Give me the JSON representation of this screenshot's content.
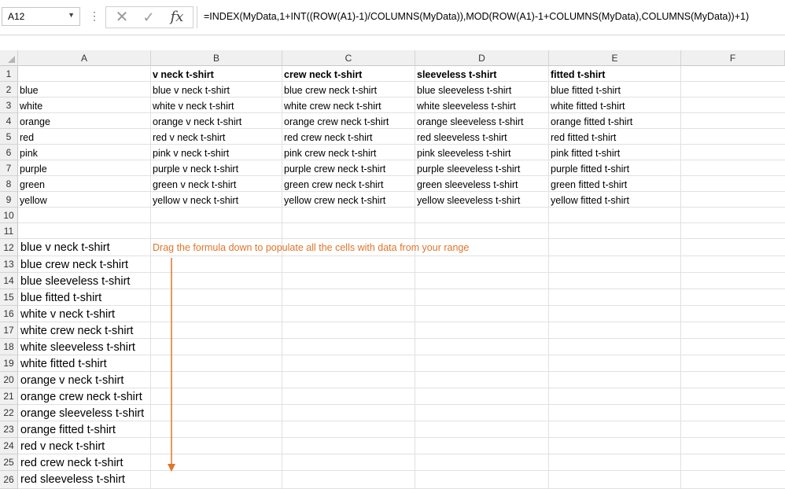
{
  "namebox": {
    "cell": "A12",
    "dropdown_icon": "chevron-down-icon"
  },
  "formula_bar": {
    "cancel_icon": "cancel-x-icon",
    "enter_icon": "check-icon",
    "fx_label": "fx",
    "formula": "=INDEX(MyData,1+INT((ROW(A1)-1)/COLUMNS(MyData)),MOD(ROW(A1)-1+COLUMNS(MyData),COLUMNS(MyData))+1)"
  },
  "columns": [
    "A",
    "B",
    "C",
    "D",
    "E",
    "F"
  ],
  "rows": [
    "1",
    "2",
    "3",
    "4",
    "5",
    "6",
    "7",
    "8",
    "9",
    "10",
    "11",
    "12",
    "13",
    "14",
    "15",
    "16",
    "17",
    "18",
    "19",
    "20",
    "21",
    "22",
    "23",
    "24",
    "25",
    "26"
  ],
  "header_row": [
    "v neck t-shirt",
    "crew neck t-shirt",
    "sleeveless t-shirt",
    "fitted t-shirt"
  ],
  "colors": [
    "blue",
    "white",
    "orange",
    "red",
    "pink",
    "purple",
    "green",
    "yellow"
  ],
  "table": [
    [
      "blue v neck t-shirt",
      "blue crew neck t-shirt",
      "blue sleeveless t-shirt",
      "blue fitted t-shirt"
    ],
    [
      "white v neck t-shirt",
      "white crew neck t-shirt",
      "white sleeveless t-shirt",
      "white fitted t-shirt"
    ],
    [
      "orange v neck t-shirt",
      "orange crew neck t-shirt",
      "orange sleeveless t-shirt",
      "orange fitted t-shirt"
    ],
    [
      "red v neck t-shirt",
      "red crew neck t-shirt",
      "red sleeveless t-shirt",
      "red fitted t-shirt"
    ],
    [
      "pink v neck t-shirt",
      "pink crew neck t-shirt",
      "pink sleeveless t-shirt",
      "pink fitted t-shirt"
    ],
    [
      "purple v neck t-shirt",
      "purple crew neck t-shirt",
      "purple sleeveless t-shirt",
      "purple fitted t-shirt"
    ],
    [
      "green v neck t-shirt",
      "green crew neck t-shirt",
      "green sleeveless t-shirt",
      "green fitted t-shirt"
    ],
    [
      "yellow v neck t-shirt",
      "yellow crew neck t-shirt",
      "yellow sleeveless t-shirt",
      "yellow fitted t-shirt"
    ]
  ],
  "results": [
    "blue v neck t-shirt",
    "blue crew neck t-shirt",
    "blue sleeveless t-shirt",
    "blue fitted t-shirt",
    "white v neck t-shirt",
    "white crew neck t-shirt",
    "white sleeveless t-shirt",
    "white fitted t-shirt",
    "orange v neck t-shirt",
    "orange crew neck t-shirt",
    "orange sleeveless t-shirt",
    "orange fitted t-shirt",
    "red v neck t-shirt",
    "red crew neck t-shirt",
    "red sleeveless t-shirt"
  ],
  "annotation": {
    "text": "Drag the formula down to populate all the cells with data from your range",
    "color": "#e0752a"
  }
}
